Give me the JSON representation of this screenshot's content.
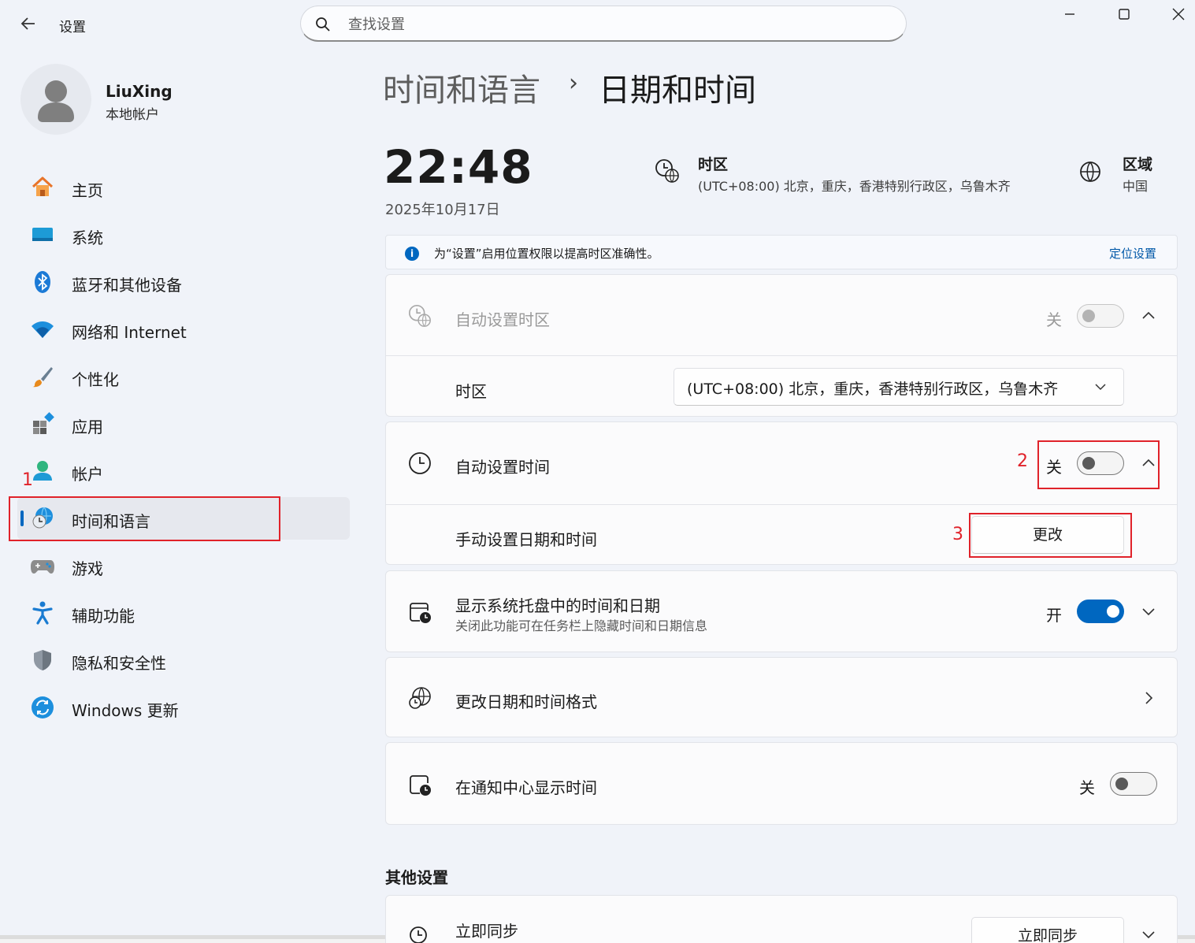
{
  "app": {
    "title": "设置"
  },
  "search": {
    "placeholder": "查找设置"
  },
  "profile": {
    "name": "LiuXing",
    "account_type": "本地帐户"
  },
  "sidebar": {
    "items": [
      {
        "label": "主页",
        "icon": "home-icon"
      },
      {
        "label": "系统",
        "icon": "system-icon"
      },
      {
        "label": "蓝牙和其他设备",
        "icon": "bluetooth-icon"
      },
      {
        "label": "网络和 Internet",
        "icon": "wifi-icon"
      },
      {
        "label": "个性化",
        "icon": "brush-icon"
      },
      {
        "label": "应用",
        "icon": "apps-icon"
      },
      {
        "label": "帐户",
        "icon": "account-icon"
      },
      {
        "label": "时间和语言",
        "icon": "time-language-icon",
        "active": true
      },
      {
        "label": "游戏",
        "icon": "gamepad-icon"
      },
      {
        "label": "辅助功能",
        "icon": "accessibility-icon"
      },
      {
        "label": "隐私和安全性",
        "icon": "shield-icon"
      },
      {
        "label": "Windows 更新",
        "icon": "windows-update-icon"
      }
    ]
  },
  "annotations": {
    "step1": "1",
    "step2": "2",
    "step3": "3",
    "color": "#e0222a"
  },
  "breadcrumb": {
    "parent": "时间和语言",
    "separator": "›",
    "current": "日期和时间"
  },
  "clock": {
    "time": "22:48",
    "date": "2025年10月17日"
  },
  "timezone_summary": {
    "title": "时区",
    "value": "(UTC+08:00) 北京，重庆，香港特别行政区，乌鲁木齐"
  },
  "region_summary": {
    "title": "区域",
    "value": "中国"
  },
  "info_bar": {
    "text": "为“设置”启用位置权限以提高时区准确性。",
    "link": "定位设置"
  },
  "auto_timezone": {
    "label": "自动设置时区",
    "state": "关",
    "on": false
  },
  "timezone_row": {
    "label": "时区",
    "value": "(UTC+08:00) 北京，重庆，香港特别行政区，乌鲁木齐"
  },
  "auto_time": {
    "label": "自动设置时间",
    "state": "关",
    "on": false
  },
  "manual_time": {
    "label": "手动设置日期和时间",
    "button": "更改"
  },
  "tray_time": {
    "label": "显示系统托盘中的时间和日期",
    "sublabel": "关闭此功能可在任务栏上隐藏时间和日期信息",
    "state": "开",
    "on": true
  },
  "format": {
    "label": "更改日期和时间格式"
  },
  "notification_time": {
    "label": "在通知中心显示时间",
    "state": "关",
    "on": false
  },
  "other_settings": {
    "title": "其他设置",
    "sync_label": "立即同步",
    "sync_button": "立即同步"
  },
  "colors": {
    "accent": "#0067c0",
    "annotation": "#e0222a"
  }
}
